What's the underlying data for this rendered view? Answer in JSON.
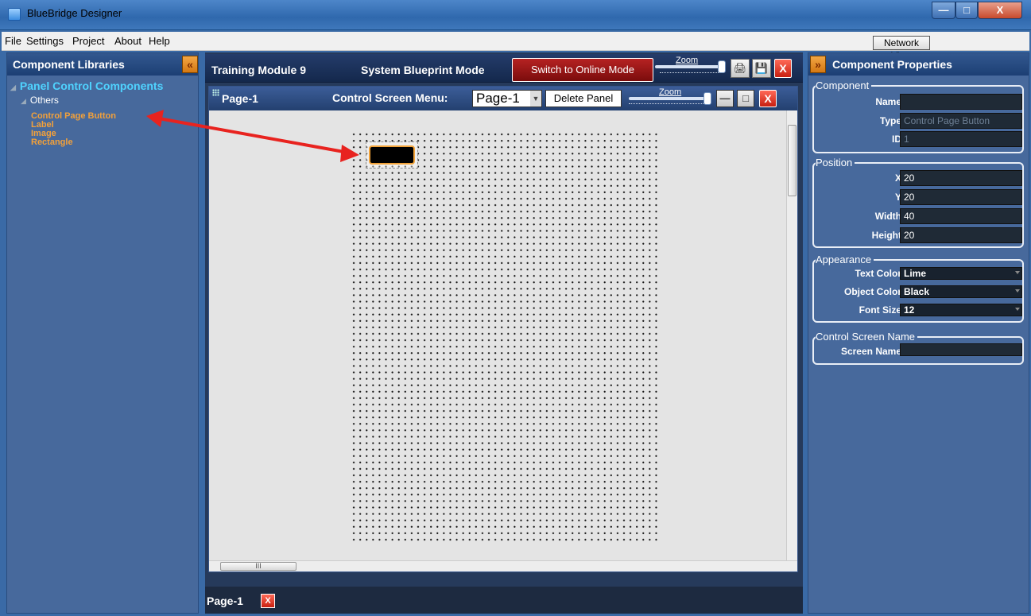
{
  "window": {
    "title": "BlueBridge Designer",
    "min": "—",
    "max": "□",
    "close": "X"
  },
  "menu": {
    "items": [
      "File",
      "Settings",
      "Project",
      "About",
      "Help"
    ],
    "network_view": "Network View"
  },
  "left_panel": {
    "title": "Component Libraries",
    "collapse_glyph": "«",
    "tree_root": "Panel Control Components",
    "group": "Others",
    "items": [
      "Control Page Button",
      "Label",
      "Image",
      "Rectangle"
    ]
  },
  "center": {
    "project": "Training Module 9",
    "mode": "System Blueprint Mode",
    "switch_button": "Switch to Online Mode",
    "zoom_label": "Zoom",
    "page": {
      "title": "Page-1",
      "menu_label": "Control Screen Menu:",
      "selected_page": "Page-1",
      "delete_button": "Delete Panel",
      "zoom_label": "Zoom"
    },
    "hscroll_glyph": "III",
    "tab": {
      "label": "Page-1",
      "close": "X"
    }
  },
  "right_panel": {
    "title": "Component Properties",
    "collapse_glyph": "»",
    "component": {
      "title": "Component",
      "name_label": "Name",
      "name": "",
      "type_label": "Type",
      "type": "Control Page Button",
      "id_label": "ID",
      "id": "1"
    },
    "position": {
      "title": "Position",
      "x_label": "X",
      "x": "20",
      "y_label": "Y",
      "y": "20",
      "width_label": "Width",
      "width": "40",
      "height_label": "Height",
      "height": "20"
    },
    "appearance": {
      "title": "Appearance",
      "text_color_label": "Text Color",
      "text_color": "Lime",
      "object_color_label": "Object Color",
      "object_color": "Black",
      "font_size_label": "Font Size",
      "font_size": "12"
    },
    "screen": {
      "title": "Control Screen Name",
      "screen_name_label": "Screen Name",
      "screen_name": ""
    }
  },
  "colors": {
    "accent_orange": "#f3a13a",
    "header_blue": "#1c3f74",
    "close_red": "#c81f10",
    "annotation_arrow": "#e8231f"
  }
}
